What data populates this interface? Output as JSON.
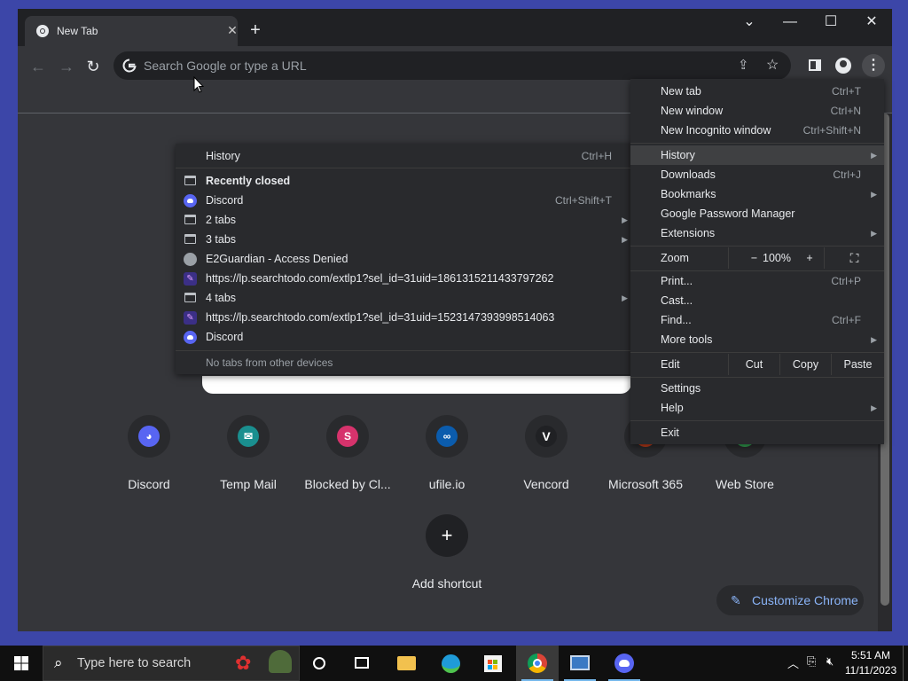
{
  "browser": {
    "tab": {
      "title": "New Tab"
    },
    "window_controls": {
      "dropdown": "⌄",
      "minimize": "—",
      "maximize": "☐",
      "close": "✕"
    },
    "omnibox": {
      "placeholder": "Search Google or type a URL"
    }
  },
  "shortcuts": [
    {
      "label": "Discord",
      "icon": "discord-icon",
      "color": "#5865f2",
      "glyph": "◕"
    },
    {
      "label": "Temp Mail",
      "icon": "temp-mail-icon",
      "color": "#1a8f8f",
      "glyph": "✉"
    },
    {
      "label": "Blocked by Cl...",
      "icon": "letter-s-icon",
      "color": "#d6336c",
      "glyph": "S"
    },
    {
      "label": "ufile.io",
      "icon": "ufile-icon",
      "color": "#0b5cad",
      "glyph": "∞"
    },
    {
      "label": "Vencord",
      "icon": "vencord-icon",
      "color": "#202124",
      "glyph": "V"
    },
    {
      "label": "Microsoft 365",
      "icon": "microsoft-365-icon",
      "color": "#c43e1c",
      "glyph": "◆"
    },
    {
      "label": "Web Store",
      "icon": "web-store-icon",
      "color": "#34a853",
      "glyph": "◈"
    }
  ],
  "add_shortcut": {
    "label": "Add shortcut"
  },
  "customize": {
    "label": "Customize Chrome"
  },
  "chrome_menu": {
    "new_tab": {
      "label": "New tab",
      "shortcut": "Ctrl+T"
    },
    "new_window": {
      "label": "New window",
      "shortcut": "Ctrl+N"
    },
    "new_incognito": {
      "label": "New Incognito window",
      "shortcut": "Ctrl+Shift+N"
    },
    "history": {
      "label": "History"
    },
    "downloads": {
      "label": "Downloads",
      "shortcut": "Ctrl+J"
    },
    "bookmarks": {
      "label": "Bookmarks"
    },
    "password_manager": {
      "label": "Google Password Manager"
    },
    "extensions": {
      "label": "Extensions"
    },
    "zoom": {
      "label": "Zoom",
      "minus": "−",
      "level": "100%",
      "plus": "+"
    },
    "print": {
      "label": "Print...",
      "shortcut": "Ctrl+P"
    },
    "cast": {
      "label": "Cast..."
    },
    "find": {
      "label": "Find...",
      "shortcut": "Ctrl+F"
    },
    "more_tools": {
      "label": "More tools"
    },
    "edit": {
      "label": "Edit",
      "cut": "Cut",
      "copy": "Copy",
      "paste": "Paste"
    },
    "settings": {
      "label": "Settings"
    },
    "help": {
      "label": "Help"
    },
    "exit": {
      "label": "Exit"
    }
  },
  "history_menu": {
    "history": {
      "label": "History",
      "shortcut": "Ctrl+H"
    },
    "recently_closed": "Recently closed",
    "items": [
      {
        "label": "Discord",
        "shortcut": "Ctrl+Shift+T",
        "icon": "discord-icon"
      },
      {
        "label": "2 tabs",
        "icon": "tab-icon"
      },
      {
        "label": "3 tabs",
        "icon": "tab-icon"
      },
      {
        "label": "E2Guardian - Access Denied",
        "icon": "globe-icon"
      },
      {
        "label": "https://lp.searchtodo.com/extlp1?sel_id=31uid=1861315211433797262",
        "icon": "link-icon"
      },
      {
        "label": "4 tabs",
        "icon": "tab-icon"
      },
      {
        "label": "https://lp.searchtodo.com/extlp1?sel_id=31uid=1523147393998514063",
        "icon": "link-icon"
      },
      {
        "label": "Discord",
        "icon": "discord-icon"
      }
    ],
    "footer": "No tabs from other devices"
  },
  "taskbar": {
    "search_placeholder": "Type here to search",
    "time": "5:51 AM",
    "date": "11/11/2023"
  }
}
